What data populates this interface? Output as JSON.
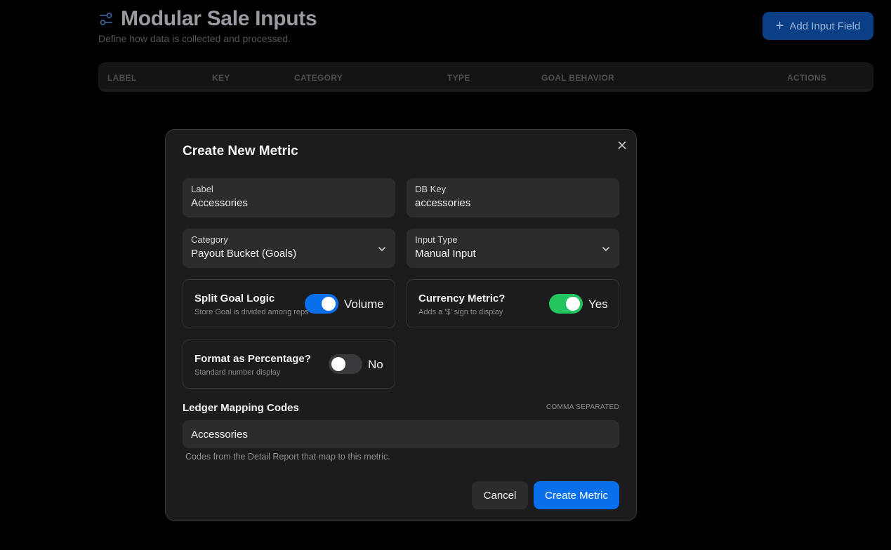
{
  "page": {
    "title": "Modular Sale Inputs",
    "title_icon": "sliders-icon",
    "subtitle": "Define how data is collected and processed.",
    "add_button_label": "Add Input Field",
    "table_columns": [
      "LABEL",
      "KEY",
      "CATEGORY",
      "TYPE",
      "GOAL BEHAVIOR",
      "ACTIONS"
    ]
  },
  "modal": {
    "title": "Create New Metric",
    "close_icon": "close-icon",
    "label_field": {
      "label": "Label",
      "value": "Accessories"
    },
    "dbkey_field": {
      "label": "DB Key",
      "value": "accessories"
    },
    "category_field": {
      "label": "Category",
      "value": "Payout Bucket (Goals)"
    },
    "input_type_field": {
      "label": "Input Type",
      "value": "Manual Input"
    },
    "split_goal": {
      "title": "Split Goal Logic",
      "description": "Store Goal is divided among reps",
      "state_label": "Volume",
      "on": true,
      "color": "#0a6fea"
    },
    "currency": {
      "title": "Currency Metric?",
      "description": "Adds a '$' sign to display",
      "state_label": "Yes",
      "on": true,
      "color": "#22c55e"
    },
    "percentage": {
      "title": "Format as Percentage?",
      "description": "Standard number display",
      "state_label": "No",
      "on": false,
      "color": "#3a3a3e"
    },
    "ledger": {
      "label": "Ledger Mapping Codes",
      "hint": "COMMA SEPARATED",
      "value": "Accessories",
      "help": "Codes from the Detail Report that map to this metric."
    },
    "cancel_label": "Cancel",
    "create_label": "Create Metric"
  },
  "colors": {
    "accent": "#0a6fea",
    "success": "#22c55e",
    "background": "#000000",
    "modal": "#1c1c1e"
  }
}
